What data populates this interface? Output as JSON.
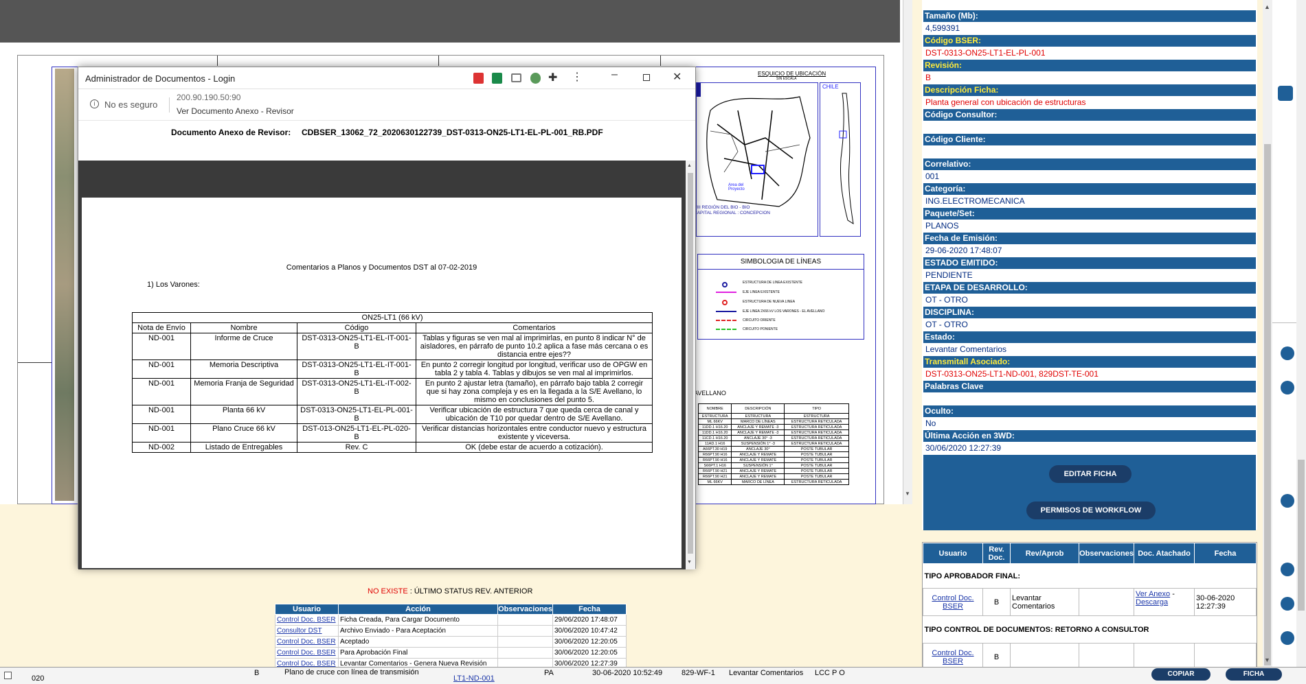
{
  "popup": {
    "window_title": "Administrador de Documentos - Login",
    "security_label": "No es seguro",
    "url": "200.90.190.50:90",
    "page_title": "Ver Documento Anexo - Revisor",
    "doc_label": "Documento Anexo de Revisor:",
    "doc_filename": "CDBSER_13062_72_2020630122739_DST-0313-ON25-LT1-EL-PL-001_RB.PDF",
    "pdf": {
      "heading": "Comentarios a Planos y Documentos DST al 07-02-2019",
      "section": "1)    Los Varones:",
      "table_title": "ON25-LT1 (66 kV)",
      "columns": [
        "Nota de Envío",
        "Nombre",
        "Código",
        "Comentarios"
      ],
      "rows": [
        {
          "nota": "ND-001",
          "nombre": "Informe de Cruce",
          "codigo": "DST-0313-ON25-LT1-EL-IT-001-B",
          "comentario": "Tablas y figuras se ven mal al imprimirlas, en punto 8 indicar N° de aisladores, en párrafo de punto 10.2 aplica a fase más cercana o es distancia entre ejes??"
        },
        {
          "nota": "ND-001",
          "nombre": "Memoria Descriptiva",
          "codigo": "DST-0313-ON25-LT1-EL-IT-001-B",
          "comentario": "En punto 2 corregir longitud por longitud, verificar uso de OPGW en tabla 2 y tabla 4. Tablas y dibujos se ven mal al imprimirlos."
        },
        {
          "nota": "ND-001",
          "nombre": "Memoria Franja de Seguridad",
          "codigo": "DST-0313-ON25-LT1-EL-IT-002-B",
          "comentario": "En punto 2 ajustar letra (tamaño), en párrafo bajo tabla 2 corregir que si hay zona compleja y es en la llegada a la S/E Avellano, lo mismo en conclusiones del punto 5."
        },
        {
          "nota": "ND-001",
          "nombre": "Planta 66 kV",
          "codigo": "DST-0313-ON25-LT1-EL-PL-001-B",
          "comentario": "Verificar ubicación de estructura 7 que queda cerca de canal y ubicación de T10 por quedar dentro de S/E Avellano."
        },
        {
          "nota": "ND-001",
          "nombre": "Plano Cruce 66 kV",
          "codigo": "DST-013-ON25-LT1-EL-PL-020-B",
          "comentario": "Verificar distancias horizontales entre conductor nuevo y estructura existente y viceversa."
        },
        {
          "nota": "ND-002",
          "nombre": "Listado de Entregables",
          "codigo": "Rev. C",
          "comentario": "OK (debe estar de acuerdo a cotización)."
        }
      ]
    }
  },
  "drawing": {
    "map_title": "ESQUICIO DE UBICACIÓN",
    "map_sub": "SIN ESCALA",
    "chile": "CHILE",
    "region": "VIII REGIÓN DEL BIO - BIO",
    "capital": "CAPITAL REGIONAL : CONCEPCION",
    "area": "Area del Proyecto",
    "simbologia_title": "SIMBOLOGIA DE LÍNEAS",
    "legend": [
      "ESTRUCTURA DE LINEA EXISTENTE",
      "EJE LINEA EXISTENTE",
      "ESTRUCTURA DE NUEVA LINEA",
      "EJE LINEA 2X66 kV LOS VARONES - EL AVELLANO",
      "CIRCUITO ORIENTE",
      "CIRCUITO PONIENTE"
    ],
    "avellano": "AVELLANO",
    "struct_cols": [
      "NOMBRE",
      "DESCRIPCIÓN",
      "TIPO"
    ],
    "struct_sub": [
      "ESTRUCTURA",
      "ESTRUCTURA",
      "ESTRUCTURA"
    ],
    "struct_rows": [
      [
        "ML 66KV",
        "MARCO DE LÍNEAS",
        "ESTRUCTURA RETICULADA"
      ],
      [
        "11DD.1 H16.20",
        "ANCLAJE Y REMATE -3",
        "ESTRUCTURA RETICULADA"
      ],
      [
        "11DD.1 H16.20",
        "ANCLAJE Y REMATE -3",
        "ESTRUCTURA RETICULADA"
      ],
      [
        "11CD.1 H16.20",
        "ANCLAJE 30° -3",
        "ESTRUCTURA RETICULADA"
      ],
      [
        "11AD.1 H16",
        "SUSPENSIÓN 1° -3",
        "ESTRUCTURA RETICULADA"
      ],
      [
        "A66PT.30 H19",
        "ANCLAJE 30°",
        "POSTE TUBULAR"
      ],
      [
        "R66PT.90 H16",
        "ANCLAJE Y REMATE",
        "POSTE TUBULAR"
      ],
      [
        "R66PT.90 H16",
        "ANCLAJE Y REMATE",
        "POSTE TUBULAR"
      ],
      [
        "S66PT.1 H16",
        "SUSPENSIÓN 1°",
        "POSTE TUBULAR"
      ],
      [
        "R66PT.90 H21",
        "ANCLAJE Y REMATE",
        "POSTE TUBULAR"
      ],
      [
        "R66PT.90 H21",
        "ANCLAJE Y REMATE",
        "POSTE TUBULAR"
      ],
      [
        "ML 66KV",
        "MARCO DE LÍNEA",
        "ESTRUCTURA RETICULADA"
      ]
    ]
  },
  "ficha": {
    "fields": [
      {
        "label": "Tamaño (Mb):",
        "value": "4,599391",
        "label_color": "white",
        "value_color": "navy"
      },
      {
        "label": "Código BSER:",
        "value": "DST-0313-ON25-LT1-EL-PL-001",
        "label_color": "yellow",
        "value_color": "red"
      },
      {
        "label": "Revisión:",
        "value": "B",
        "label_color": "yellow",
        "value_color": "red"
      },
      {
        "label": "Descripción Ficha:",
        "value": "Planta general con ubicación de estructuras",
        "label_color": "yellow",
        "value_color": "red"
      },
      {
        "label": "Código Consultor:",
        "value": "",
        "label_color": "white",
        "value_color": "navy"
      },
      {
        "label": "Código Cliente:",
        "value": "",
        "label_color": "white",
        "value_color": "navy"
      },
      {
        "label": "Correlativo:",
        "value": "001",
        "label_color": "white",
        "value_color": "navy"
      },
      {
        "label": "Categoría:",
        "value": "ING.ELECTROMECANICA",
        "label_color": "white",
        "value_color": "navy"
      },
      {
        "label": "Paquete/Set:",
        "value": "PLANOS",
        "label_color": "white",
        "value_color": "navy"
      },
      {
        "label": "Fecha de Emisión:",
        "value": "29-06-2020 17:48:07",
        "label_color": "white",
        "value_color": "navy"
      },
      {
        "label": "ESTADO EMITIDO:",
        "value": "PENDIENTE",
        "label_color": "white",
        "value_color": "navy"
      },
      {
        "label": "ETAPA DE DESARROLLO:",
        "value": "OT - OTRO",
        "label_color": "white",
        "value_color": "navy"
      },
      {
        "label": "DISCIPLINA:",
        "value": "OT - OTRO",
        "label_color": "white",
        "value_color": "navy"
      },
      {
        "label": "Estado:",
        "value": "Levantar Comentarios",
        "label_color": "white",
        "value_color": "navy"
      },
      {
        "label": "Transmitall Asociado:",
        "value": "DST-0313-ON25-LT1-ND-001, 829DST-TE-001",
        "label_color": "yellow",
        "value_color": "red"
      },
      {
        "label": "Palabras Clave",
        "value": "",
        "label_color": "white",
        "value_color": "navy"
      },
      {
        "label": "Oculto:",
        "value": "No",
        "label_color": "white",
        "value_color": "navy"
      },
      {
        "label": "Última Acción en 3WD:",
        "value": "30/06/2020 12:27:39",
        "label_color": "white",
        "value_color": "navy"
      }
    ],
    "edit_button": "EDITAR FICHA",
    "workflow_button": "PERMISOS DE WORKFLOW"
  },
  "workflow": {
    "columns": [
      "Usuario",
      "Rev. Doc.",
      "Rev/Aprob",
      "Observaciones",
      "Doc. Atachado",
      "Fecha"
    ],
    "group1": "TIPO APROBADOR FINAL:",
    "row1": {
      "usuario": "Control Doc. BSER",
      "rev": "B",
      "revaprob": "Levantar Comentarios",
      "obs": "",
      "doc1": "Ver Anexo",
      "doc_sep": " - ",
      "doc2": "Descarga",
      "fecha": "30-06-2020 12:27:39"
    },
    "group2": "TIPO CONTROL DE DOCUMENTOS: RETORNO A CONSULTOR",
    "row2": {
      "usuario": "Control Doc. BSER",
      "rev": "B"
    }
  },
  "history": {
    "warning_prefix": "NO EXISTE",
    "warning_rest": " : ÚLTIMO STATUS REV. ANTERIOR",
    "columns": [
      "Usuario",
      "Acción",
      "Observaciones",
      "Fecha"
    ],
    "rows": [
      {
        "usuario": "Control Doc. BSER",
        "accion": "Ficha Creada, Para Cargar Documento",
        "obs": "",
        "fecha": "29/06/2020 17:48:07"
      },
      {
        "usuario": "Consultor DST",
        "accion": "Archivo Enviado - Para Aceptación",
        "obs": "",
        "fecha": "30/06/2020 10:47:42"
      },
      {
        "usuario": "Control Doc. BSER",
        "accion": "Aceptado",
        "obs": "",
        "fecha": "30/06/2020 12:20:05"
      },
      {
        "usuario": "Control Doc. BSER",
        "accion": "Para Aprobación Final",
        "obs": "",
        "fecha": "30/06/2020 12:20:05"
      },
      {
        "usuario": "Control Doc. BSER",
        "accion": "Levantar Comentarios - Genera Nueva Revisión",
        "obs": "",
        "fecha": "30/06/2020 12:27:39"
      }
    ]
  },
  "statusbar": {
    "code": "020",
    "rev": "B",
    "desc": "Plano de cruce con línea de transmisión",
    "link": "LT1-ND-001",
    "pa": "PA",
    "date": "30-06-2020 10:52:49",
    "wf": "829-WF-1",
    "estado": "Levantar Comentarios",
    "flags": "LCC P O",
    "copiar": "COPIAR",
    "ficha": "FICHA"
  },
  "colors": {
    "header_blue": "#1f5f97",
    "accent_yellow": "#ffeb3b",
    "red": "#e00000",
    "cream": "#fdf5dc"
  }
}
